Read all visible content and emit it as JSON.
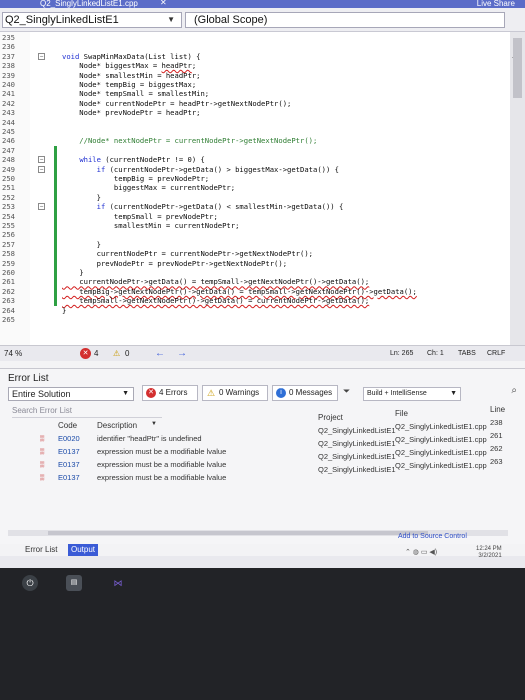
{
  "window": {
    "title": "Q2_SinglyLinkedListE1.cpp",
    "share_label": "Live Share",
    "close_glyph": "✕"
  },
  "nav": {
    "file": "Q2_SinglyLinkedListE1",
    "scope": "(Global Scope)"
  },
  "editor": {
    "lines": [
      {
        "n": "235",
        "t": ""
      },
      {
        "n": "236",
        "t": ""
      },
      {
        "n": "237",
        "t": "void SwapMinMaxData(List list) {"
      },
      {
        "n": "238",
        "t": "    Node* biggestMax = headPtr;"
      },
      {
        "n": "239",
        "t": "    Node* smallestMin = headPtr;"
      },
      {
        "n": "240",
        "t": "    Node* tempBig = biggestMax;"
      },
      {
        "n": "241",
        "t": "    Node* tempSmall = smallestMin;"
      },
      {
        "n": "242",
        "t": "    Node* currentNodePtr = headPtr->getNextNodePtr();"
      },
      {
        "n": "243",
        "t": "    Node* prevNodePtr = headPtr;"
      },
      {
        "n": "244",
        "t": ""
      },
      {
        "n": "245",
        "t": ""
      },
      {
        "n": "246",
        "t": "    //Node* nextNodePtr = currentNodePtr->getNextNodePtr();"
      },
      {
        "n": "247",
        "t": ""
      },
      {
        "n": "248",
        "t": "    while (currentNodePtr != 0) {"
      },
      {
        "n": "249",
        "t": "        if (currentNodePtr->getData() > biggestMax->getData()) {"
      },
      {
        "n": "250",
        "t": "            tempBig = prevNodePtr;"
      },
      {
        "n": "251",
        "t": "            biggestMax = currentNodePtr;"
      },
      {
        "n": "252",
        "t": "        }"
      },
      {
        "n": "253",
        "t": "        if (currentNodePtr->getData() < smallestMin->getData()) {"
      },
      {
        "n": "254",
        "t": "            tempSmall = prevNodePtr;"
      },
      {
        "n": "255",
        "t": "            smallestMin = currentNodePtr;"
      },
      {
        "n": "256",
        "t": ""
      },
      {
        "n": "257",
        "t": "        }"
      },
      {
        "n": "258",
        "t": "        currentNodePtr = currentNodePtr->getNextNodePtr();"
      },
      {
        "n": "259",
        "t": "        prevNodePtr = prevNodePtr->getNextNodePtr();"
      },
      {
        "n": "260",
        "t": "    }"
      },
      {
        "n": "261",
        "t": "    currentNodePtr->getData() = tempSmall->getNextNodePtr()->getData();"
      },
      {
        "n": "262",
        "t": "    tempBig->getNextNodePtr()->getData() = tempSmall->getNextNodePtr()->getData();"
      },
      {
        "n": "263",
        "t": "    tempSmall->getNextNodePtr()->getData() = currentNodePtr->getData();"
      },
      {
        "n": "264",
        "t": "}"
      },
      {
        "n": "265",
        "t": ""
      }
    ]
  },
  "editor_status": {
    "zoom": "74 %",
    "errors": "4",
    "warnings": "0",
    "line": "Ln: 265",
    "col": "Ch: 1",
    "tabs": "TABS",
    "eol": "CRLF"
  },
  "error_list": {
    "title": "Error List",
    "scope": "Entire Solution",
    "errors_btn": "4 Errors",
    "warnings_btn": "0 Warnings",
    "messages_btn": "0 Messages",
    "build_filter": "Build + IntelliSense",
    "search_placeholder": "Search Error List",
    "headers": {
      "code": "Code",
      "description": "Description",
      "project": "Project",
      "file": "File",
      "line": "Line"
    },
    "rows": [
      {
        "code": "E0020",
        "description": "identifier \"headPtr\" is undefined",
        "project": "Q2_SinglyLinkedListE1",
        "file": "Q2_SinglyLinkedListE1.cpp",
        "line": "238"
      },
      {
        "code": "E0137",
        "description": "expression must be a modifiable lvalue",
        "project": "Q2_SinglyLinkedListE1",
        "file": "Q2_SinglyLinkedListE1.cpp",
        "line": "261"
      },
      {
        "code": "E0137",
        "description": "expression must be a modifiable lvalue",
        "project": "Q2_SinglyLinkedListE1",
        "file": "Q2_SinglyLinkedListE1.cpp",
        "line": "262"
      },
      {
        "code": "E0137",
        "description": "expression must be a modifiable lvalue",
        "project": "Q2_SinglyLinkedListE1",
        "file": "Q2_SinglyLinkedListE1.cpp",
        "line": "263"
      }
    ]
  },
  "bottom_tabs": {
    "error_list": "Error List",
    "output": "Output"
  },
  "status": {
    "source_control": "Add to Source Control"
  },
  "taskbar": {
    "time": "12:24 PM",
    "date": "3/2/2021"
  },
  "colors": {
    "accent": "#3a5bd6",
    "error": "#d32f2f",
    "warning": "#c99a00",
    "info": "#2f6fd6"
  }
}
